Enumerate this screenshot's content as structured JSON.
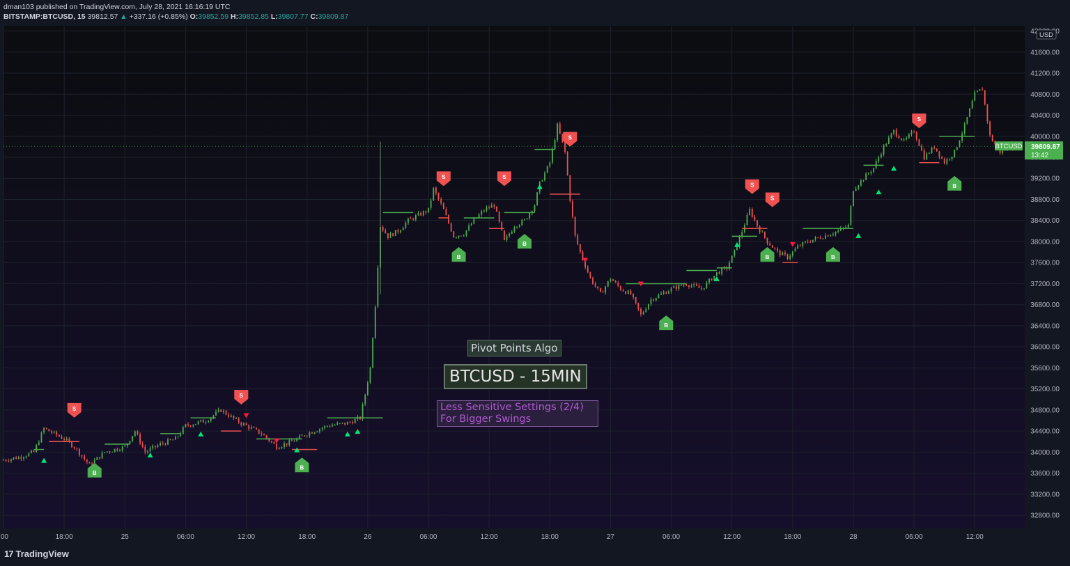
{
  "header": {
    "publisher": "dman103 published on TradingView.com, July 28, 2021 16:16:19 UTC",
    "symbol": "BITSTAMP:BTCUSD, 15",
    "last": "39812.57",
    "up_arrow": "▲",
    "change": "+337.16 (+0.85%)",
    "o_label": "O:",
    "o_value": "39852.59",
    "h_label": "H:",
    "h_value": "39852.85",
    "l_label": "L:",
    "l_value": "39807.77",
    "c_label": "C:",
    "c_value": "39809.87"
  },
  "labels": {
    "algo": "Pivot Points Algo",
    "title": "BTCUSD - 15MIN",
    "settings_line1": "Less Sensitive Settings (2/4)",
    "settings_line2": "For Bigger Swings"
  },
  "price_tag": {
    "symbol": "BTCUSD",
    "price": "39809.87",
    "countdown": "13:42"
  },
  "currency": "USD",
  "footer": {
    "brand": "TradingView",
    "mark": "17"
  },
  "colors": {
    "background": "#131722",
    "bull": "#4caf50",
    "bear": "#ef5350",
    "buy_marker": "#4caf50",
    "sell_marker": "#f05252",
    "pivot_up": "#00e676",
    "pivot_down": "#ff1744"
  },
  "chart_data": {
    "type": "candlestick",
    "y_ticks": [
      42000,
      41600,
      41200,
      40800,
      40400,
      40000,
      39600,
      39200,
      38800,
      38400,
      38000,
      37600,
      37200,
      36800,
      36400,
      36000,
      35600,
      35200,
      34800,
      34400,
      34000,
      33600,
      33200,
      32800
    ],
    "ylim": [
      32550,
      42100
    ],
    "x_ticks": [
      ":00",
      "18:00",
      "25",
      "06:00",
      "12:00",
      "18:00",
      "26",
      "06:00",
      "12:00",
      "18:00",
      "27",
      "06:00",
      "12:00",
      "18:00",
      "28",
      "06:00",
      "12:00"
    ],
    "x_tick_times": [
      "2021-07-24 12:00",
      "2021-07-24 18:00",
      "2021-07-25 00:00",
      "2021-07-25 06:00",
      "2021-07-25 12:00",
      "2021-07-25 18:00",
      "2021-07-26 00:00",
      "2021-07-26 06:00",
      "2021-07-26 12:00",
      "2021-07-26 18:00",
      "2021-07-27 00:00",
      "2021-07-27 06:00",
      "2021-07-27 12:00",
      "2021-07-27 18:00",
      "2021-07-28 00:00",
      "2021-07-28 06:00",
      "2021-07-28 12:00"
    ],
    "x_range": [
      "2021-07-24 12:00",
      "2021-07-28 16:15"
    ],
    "price_path": [
      [
        "2021-07-24 12:00",
        33850
      ],
      [
        "2021-07-24 13:30",
        33900
      ],
      [
        "2021-07-24 15:00",
        34000
      ],
      [
        "2021-07-24 16:00",
        34450
      ],
      [
        "2021-07-24 17:00",
        34350
      ],
      [
        "2021-07-24 18:00",
        34250
      ],
      [
        "2021-07-24 19:00",
        34100
      ],
      [
        "2021-07-24 20:30",
        33750
      ],
      [
        "2021-07-24 22:00",
        34000
      ],
      [
        "2021-07-25 00:00",
        34100
      ],
      [
        "2021-07-25 01:00",
        34400
      ],
      [
        "2021-07-25 02:00",
        34000
      ],
      [
        "2021-07-25 03:30",
        34150
      ],
      [
        "2021-07-25 05:00",
        34250
      ],
      [
        "2021-07-25 06:00",
        34500
      ],
      [
        "2021-07-25 08:00",
        34600
      ],
      [
        "2021-07-25 09:30",
        34800
      ],
      [
        "2021-07-25 11:00",
        34600
      ],
      [
        "2021-07-25 12:00",
        34500
      ],
      [
        "2021-07-25 13:30",
        34350
      ],
      [
        "2021-07-25 15:00",
        34100
      ],
      [
        "2021-07-25 16:30",
        34200
      ],
      [
        "2021-07-25 18:00",
        34350
      ],
      [
        "2021-07-25 20:00",
        34500
      ],
      [
        "2021-07-25 22:00",
        34550
      ],
      [
        "2021-07-25 23:15",
        34650
      ],
      [
        "2021-07-25 23:45",
        35100
      ],
      [
        "2021-07-26 00:15",
        35600
      ],
      [
        "2021-07-26 00:45",
        36800
      ],
      [
        "2021-07-26 01:15",
        38300
      ],
      [
        "2021-07-26 02:00",
        38100
      ],
      [
        "2021-07-26 03:00",
        38200
      ],
      [
        "2021-07-26 04:00",
        38400
      ],
      [
        "2021-07-26 05:00",
        38500
      ],
      [
        "2021-07-26 06:00",
        38600
      ],
      [
        "2021-07-26 06:30",
        39000
      ],
      [
        "2021-07-26 07:30",
        38600
      ],
      [
        "2021-07-26 08:30",
        38100
      ],
      [
        "2021-07-26 09:30",
        38150
      ],
      [
        "2021-07-26 10:30",
        38400
      ],
      [
        "2021-07-26 11:30",
        38600
      ],
      [
        "2021-07-26 12:30",
        38700
      ],
      [
        "2021-07-26 13:30",
        38000
      ],
      [
        "2021-07-26 14:30",
        38300
      ],
      [
        "2021-07-26 15:30",
        38400
      ],
      [
        "2021-07-26 16:30",
        38700
      ],
      [
        "2021-07-26 17:00",
        39100
      ],
      [
        "2021-07-26 18:00",
        39500
      ],
      [
        "2021-07-26 18:45",
        40200
      ],
      [
        "2021-07-26 19:30",
        39700
      ],
      [
        "2021-07-26 20:00",
        38800
      ],
      [
        "2021-07-26 20:30",
        38100
      ],
      [
        "2021-07-26 21:00",
        37800
      ],
      [
        "2021-07-26 22:00",
        37300
      ],
      [
        "2021-07-26 23:00",
        37000
      ],
      [
        "2021-07-27 00:00",
        37300
      ],
      [
        "2021-07-27 01:00",
        37100
      ],
      [
        "2021-07-27 02:00",
        37000
      ],
      [
        "2021-07-27 03:00",
        36600
      ],
      [
        "2021-07-27 04:00",
        36900
      ],
      [
        "2021-07-27 05:00",
        37000
      ],
      [
        "2021-07-27 06:00",
        37100
      ],
      [
        "2021-07-27 07:30",
        37200
      ],
      [
        "2021-07-27 09:00",
        37100
      ],
      [
        "2021-07-27 10:30",
        37400
      ],
      [
        "2021-07-27 11:30",
        37500
      ],
      [
        "2021-07-27 12:15",
        37800
      ],
      [
        "2021-07-27 13:00",
        38200
      ],
      [
        "2021-07-27 13:45",
        38600
      ],
      [
        "2021-07-27 14:30",
        38300
      ],
      [
        "2021-07-27 15:30",
        38000
      ],
      [
        "2021-07-27 16:30",
        37800
      ],
      [
        "2021-07-27 17:30",
        37700
      ],
      [
        "2021-07-27 18:30",
        37900
      ],
      [
        "2021-07-27 19:30",
        38000
      ],
      [
        "2021-07-27 21:00",
        38100
      ],
      [
        "2021-07-27 22:30",
        38200
      ],
      [
        "2021-07-27 23:30",
        38300
      ],
      [
        "2021-07-28 00:00",
        39000
      ],
      [
        "2021-07-28 01:00",
        39200
      ],
      [
        "2021-07-28 02:00",
        39400
      ],
      [
        "2021-07-28 03:00",
        39800
      ],
      [
        "2021-07-28 04:00",
        40100
      ],
      [
        "2021-07-28 05:00",
        39900
      ],
      [
        "2021-07-28 06:00",
        40100
      ],
      [
        "2021-07-28 07:00",
        39600
      ],
      [
        "2021-07-28 08:00",
        39800
      ],
      [
        "2021-07-28 09:00",
        39500
      ],
      [
        "2021-07-28 10:00",
        39700
      ],
      [
        "2021-07-28 11:00",
        40200
      ],
      [
        "2021-07-28 12:00",
        40800
      ],
      [
        "2021-07-28 12:45",
        40900
      ],
      [
        "2021-07-28 13:30",
        40000
      ],
      [
        "2021-07-28 14:30",
        39700
      ],
      [
        "2021-07-28 15:30",
        39800
      ],
      [
        "2021-07-28 16:15",
        39810
      ]
    ],
    "pivot_lines": [
      {
        "dir": "up",
        "start": "2021-07-24 15:00",
        "end": "2021-07-24 16:00",
        "price": 34050
      },
      {
        "dir": "down",
        "start": "2021-07-24 16:30",
        "end": "2021-07-24 19:30",
        "price": 34200
      },
      {
        "dir": "up",
        "start": "2021-07-24 22:00",
        "end": "2021-07-25 00:30",
        "price": 34150
      },
      {
        "dir": "up",
        "start": "2021-07-25 03:30",
        "end": "2021-07-25 05:30",
        "price": 34350
      },
      {
        "dir": "up",
        "start": "2021-07-25 06:30",
        "end": "2021-07-25 09:00",
        "price": 34650
      },
      {
        "dir": "down",
        "start": "2021-07-25 09:30",
        "end": "2021-07-25 11:30",
        "price": 34400
      },
      {
        "dir": "up",
        "start": "2021-07-25 13:00",
        "end": "2021-07-25 17:30",
        "price": 34250
      },
      {
        "dir": "down",
        "start": "2021-07-25 16:30",
        "end": "2021-07-25 19:00",
        "price": 34050
      },
      {
        "dir": "up",
        "start": "2021-07-25 20:00",
        "end": "2021-07-26 01:30",
        "price": 34650
      },
      {
        "dir": "up",
        "start": "2021-07-26 01:30",
        "end": "2021-07-26 04:30",
        "price": 38550
      },
      {
        "dir": "down",
        "start": "2021-07-26 07:00",
        "end": "2021-07-26 08:00",
        "price": 38450
      },
      {
        "dir": "up",
        "start": "2021-07-26 09:30",
        "end": "2021-07-26 12:30",
        "price": 38450
      },
      {
        "dir": "down",
        "start": "2021-07-26 12:00",
        "end": "2021-07-26 13:30",
        "price": 38250
      },
      {
        "dir": "up",
        "start": "2021-07-26 13:30",
        "end": "2021-07-26 16:30",
        "price": 38550
      },
      {
        "dir": "up",
        "start": "2021-07-26 16:30",
        "end": "2021-07-26 18:30",
        "price": 39750
      },
      {
        "dir": "down",
        "start": "2021-07-26 18:00",
        "end": "2021-07-26 21:00",
        "price": 38900
      },
      {
        "dir": "up",
        "start": "2021-07-27 01:30",
        "end": "2021-07-27 07:30",
        "price": 37200
      },
      {
        "dir": "up",
        "start": "2021-07-27 07:30",
        "end": "2021-07-27 10:30",
        "price": 37450
      },
      {
        "dir": "up",
        "start": "2021-07-27 10:30",
        "end": "2021-07-27 12:00",
        "price": 37500
      },
      {
        "dir": "up",
        "start": "2021-07-27 12:00",
        "end": "2021-07-27 14:30",
        "price": 38100
      },
      {
        "dir": "down",
        "start": "2021-07-27 13:00",
        "end": "2021-07-27 15:30",
        "price": 38250
      },
      {
        "dir": "down",
        "start": "2021-07-27 17:00",
        "end": "2021-07-27 18:30",
        "price": 37600
      },
      {
        "dir": "up",
        "start": "2021-07-27 19:00",
        "end": "2021-07-28 00:00",
        "price": 38250
      },
      {
        "dir": "up",
        "start": "2021-07-28 01:00",
        "end": "2021-07-28 03:00",
        "price": 39450
      },
      {
        "dir": "down",
        "start": "2021-07-28 06:30",
        "end": "2021-07-28 08:30",
        "price": 39500
      },
      {
        "dir": "up",
        "start": "2021-07-28 08:30",
        "end": "2021-07-28 12:00",
        "price": 40000
      }
    ],
    "buy_signals": [
      {
        "time": "2021-07-24 21:00",
        "price": 33650
      },
      {
        "time": "2021-07-25 17:30",
        "price": 33750
      },
      {
        "time": "2021-07-26 09:00",
        "price": 37750
      },
      {
        "time": "2021-07-26 15:30",
        "price": 38000
      },
      {
        "time": "2021-07-27 05:30",
        "price": 36450
      },
      {
        "time": "2021-07-27 15:30",
        "price": 37750
      },
      {
        "time": "2021-07-27 22:00",
        "price": 37750
      },
      {
        "time": "2021-07-28 10:00",
        "price": 39100
      }
    ],
    "sell_signals": [
      {
        "time": "2021-07-24 19:00",
        "price": 34800
      },
      {
        "time": "2021-07-25 11:30",
        "price": 35050
      },
      {
        "time": "2021-07-26 07:30",
        "price": 39200
      },
      {
        "time": "2021-07-26 13:30",
        "price": 39200
      },
      {
        "time": "2021-07-26 20:00",
        "price": 39950
      },
      {
        "time": "2021-07-27 14:00",
        "price": 39050
      },
      {
        "time": "2021-07-27 16:00",
        "price": 38800
      },
      {
        "time": "2021-07-28 06:30",
        "price": 40300
      }
    ],
    "pivot_up_marks": [
      {
        "time": "2021-07-24 16:00",
        "price": 33850
      },
      {
        "time": "2021-07-25 02:30",
        "price": 33950
      },
      {
        "time": "2021-07-25 07:30",
        "price": 34350
      },
      {
        "time": "2021-07-25 17:00",
        "price": 34050
      },
      {
        "time": "2021-07-25 22:00",
        "price": 34350
      },
      {
        "time": "2021-07-25 23:00",
        "price": 34400
      },
      {
        "time": "2021-07-26 17:00",
        "price": 39050
      },
      {
        "time": "2021-07-27 12:30",
        "price": 37950
      },
      {
        "time": "2021-07-27 10:30",
        "price": 37300
      },
      {
        "time": "2021-07-28 00:30",
        "price": 38120
      },
      {
        "time": "2021-07-28 02:30",
        "price": 38950
      },
      {
        "time": "2021-07-28 04:00",
        "price": 39400
      }
    ],
    "pivot_down_marks": [
      {
        "time": "2021-07-25 12:00",
        "price": 34700
      },
      {
        "time": "2021-07-25 15:00",
        "price": 34220
      },
      {
        "time": "2021-07-26 21:30",
        "price": 37650
      },
      {
        "time": "2021-07-27 03:00",
        "price": 37200
      },
      {
        "time": "2021-07-27 18:00",
        "price": 37950
      }
    ],
    "last_price": 39809.87
  }
}
